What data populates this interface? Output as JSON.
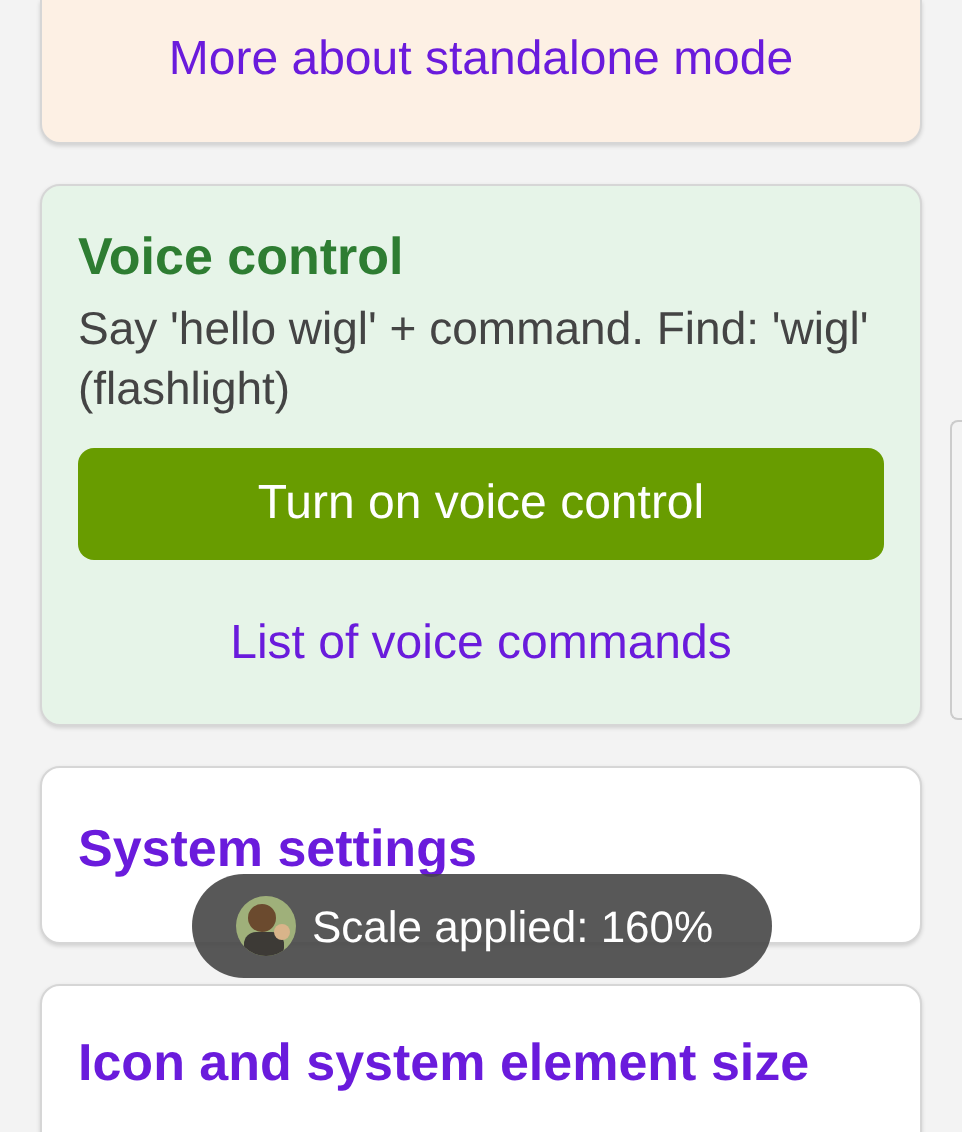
{
  "standalone_card": {
    "link": "More about standalone mode"
  },
  "voice_card": {
    "title": "Voice control",
    "description": "Say 'hello wigl' + command. Find: 'wigl' (flashlight)",
    "button": "Turn on voice control",
    "link": "List of voice commands"
  },
  "system_card": {
    "title": "System settings"
  },
  "size_card": {
    "title": "Icon and system element size"
  },
  "toast": {
    "text": "Scale applied: 160%"
  }
}
